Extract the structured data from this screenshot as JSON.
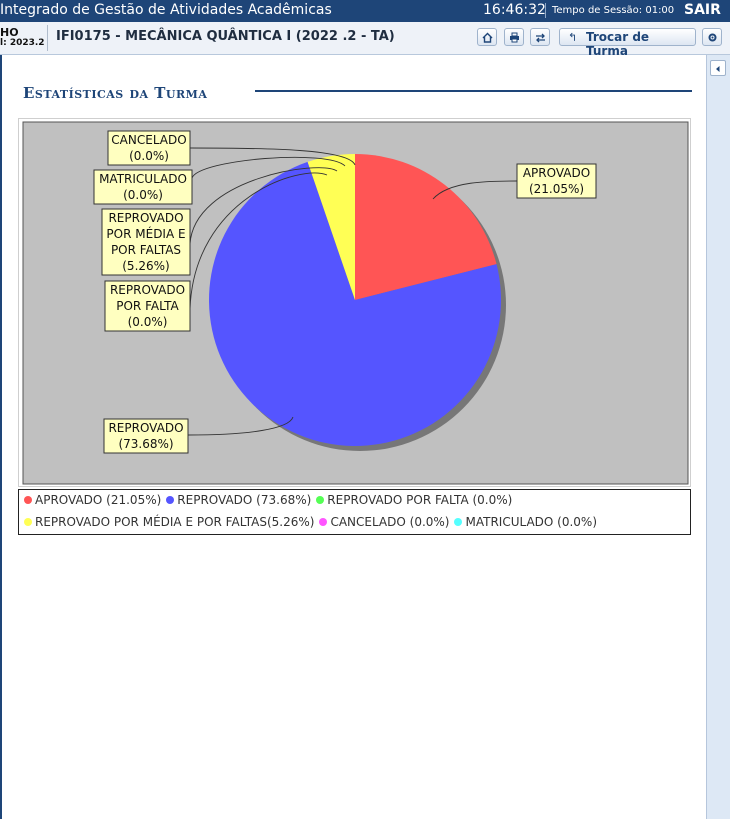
{
  "topbar": {
    "system_title": "Integrado de Gestão de Atividades Acadêmicas",
    "clock": "16:46:32",
    "session_label": "Tempo de Sessão: 01:00",
    "logout": "SAIR"
  },
  "subbar": {
    "user_line1": "HO",
    "user_line2": "l: 2023.2",
    "course": "IFI0175 - MECÂNICA QUÂNTICA I (2022 .2 - TA)",
    "trocar_label": "Trocar de Turma"
  },
  "section": {
    "title": "Estatísticas da Turma"
  },
  "chart_data": {
    "type": "pie",
    "slices": [
      {
        "label": "APROVADO",
        "pct_label": "(21.05%)",
        "value": 21.05,
        "color": "#ff5555"
      },
      {
        "label": "REPROVADO",
        "pct_label": "(73.68%)",
        "value": 73.68,
        "color": "#5555ff"
      },
      {
        "label": "REPROVADO POR FALTA",
        "pct_label": "(0.0%)",
        "value": 0.0,
        "color": "#55ff55"
      },
      {
        "label": "REPROVADO POR MÉDIA E POR FALTAS",
        "pct_label": "(5.26%)",
        "value": 5.26,
        "color": "#ffff55"
      },
      {
        "label": "CANCELADO",
        "pct_label": "(0.0%)",
        "value": 0.0,
        "color": "#ff55ff"
      },
      {
        "label": "MATRICULADO",
        "pct_label": "(0.0%)",
        "value": 0.0,
        "color": "#55ffff"
      }
    ],
    "callouts": {
      "aprovado": [
        "APROVADO",
        "(21.05%)"
      ],
      "reprovado": [
        "REPROVADO",
        "(73.68%)"
      ],
      "cancelado": [
        "CANCELADO",
        "(0.0%)"
      ],
      "matriculado": [
        "MATRICULADO",
        "(0.0%)"
      ],
      "media_faltas": [
        "REPROVADO",
        "POR MÉDIA E",
        "POR FALTAS",
        "(5.26%)"
      ],
      "falta": [
        "REPROVADO",
        "POR FALTA",
        "(0.0%)"
      ]
    },
    "legend_rows": [
      [
        {
          "text": "APROVADO (21.05%)",
          "color": "#ff5555"
        },
        {
          "text": "REPROVADO (73.68%)",
          "color": "#5555ff"
        },
        {
          "text": "REPROVADO POR FALTA (0.0%)",
          "color": "#55ff55"
        }
      ],
      [
        {
          "text": "REPROVADO POR MÉDIA E POR FALTAS(5.26%)",
          "color": "#ffff55"
        },
        {
          "text": "CANCELADO (0.0%)",
          "color": "#ff55ff"
        },
        {
          "text": "MATRICULADO (0.0%)",
          "color": "#55ffff"
        }
      ]
    ],
    "plot_background": "#c0c0c0",
    "legend_position": "bottom"
  }
}
